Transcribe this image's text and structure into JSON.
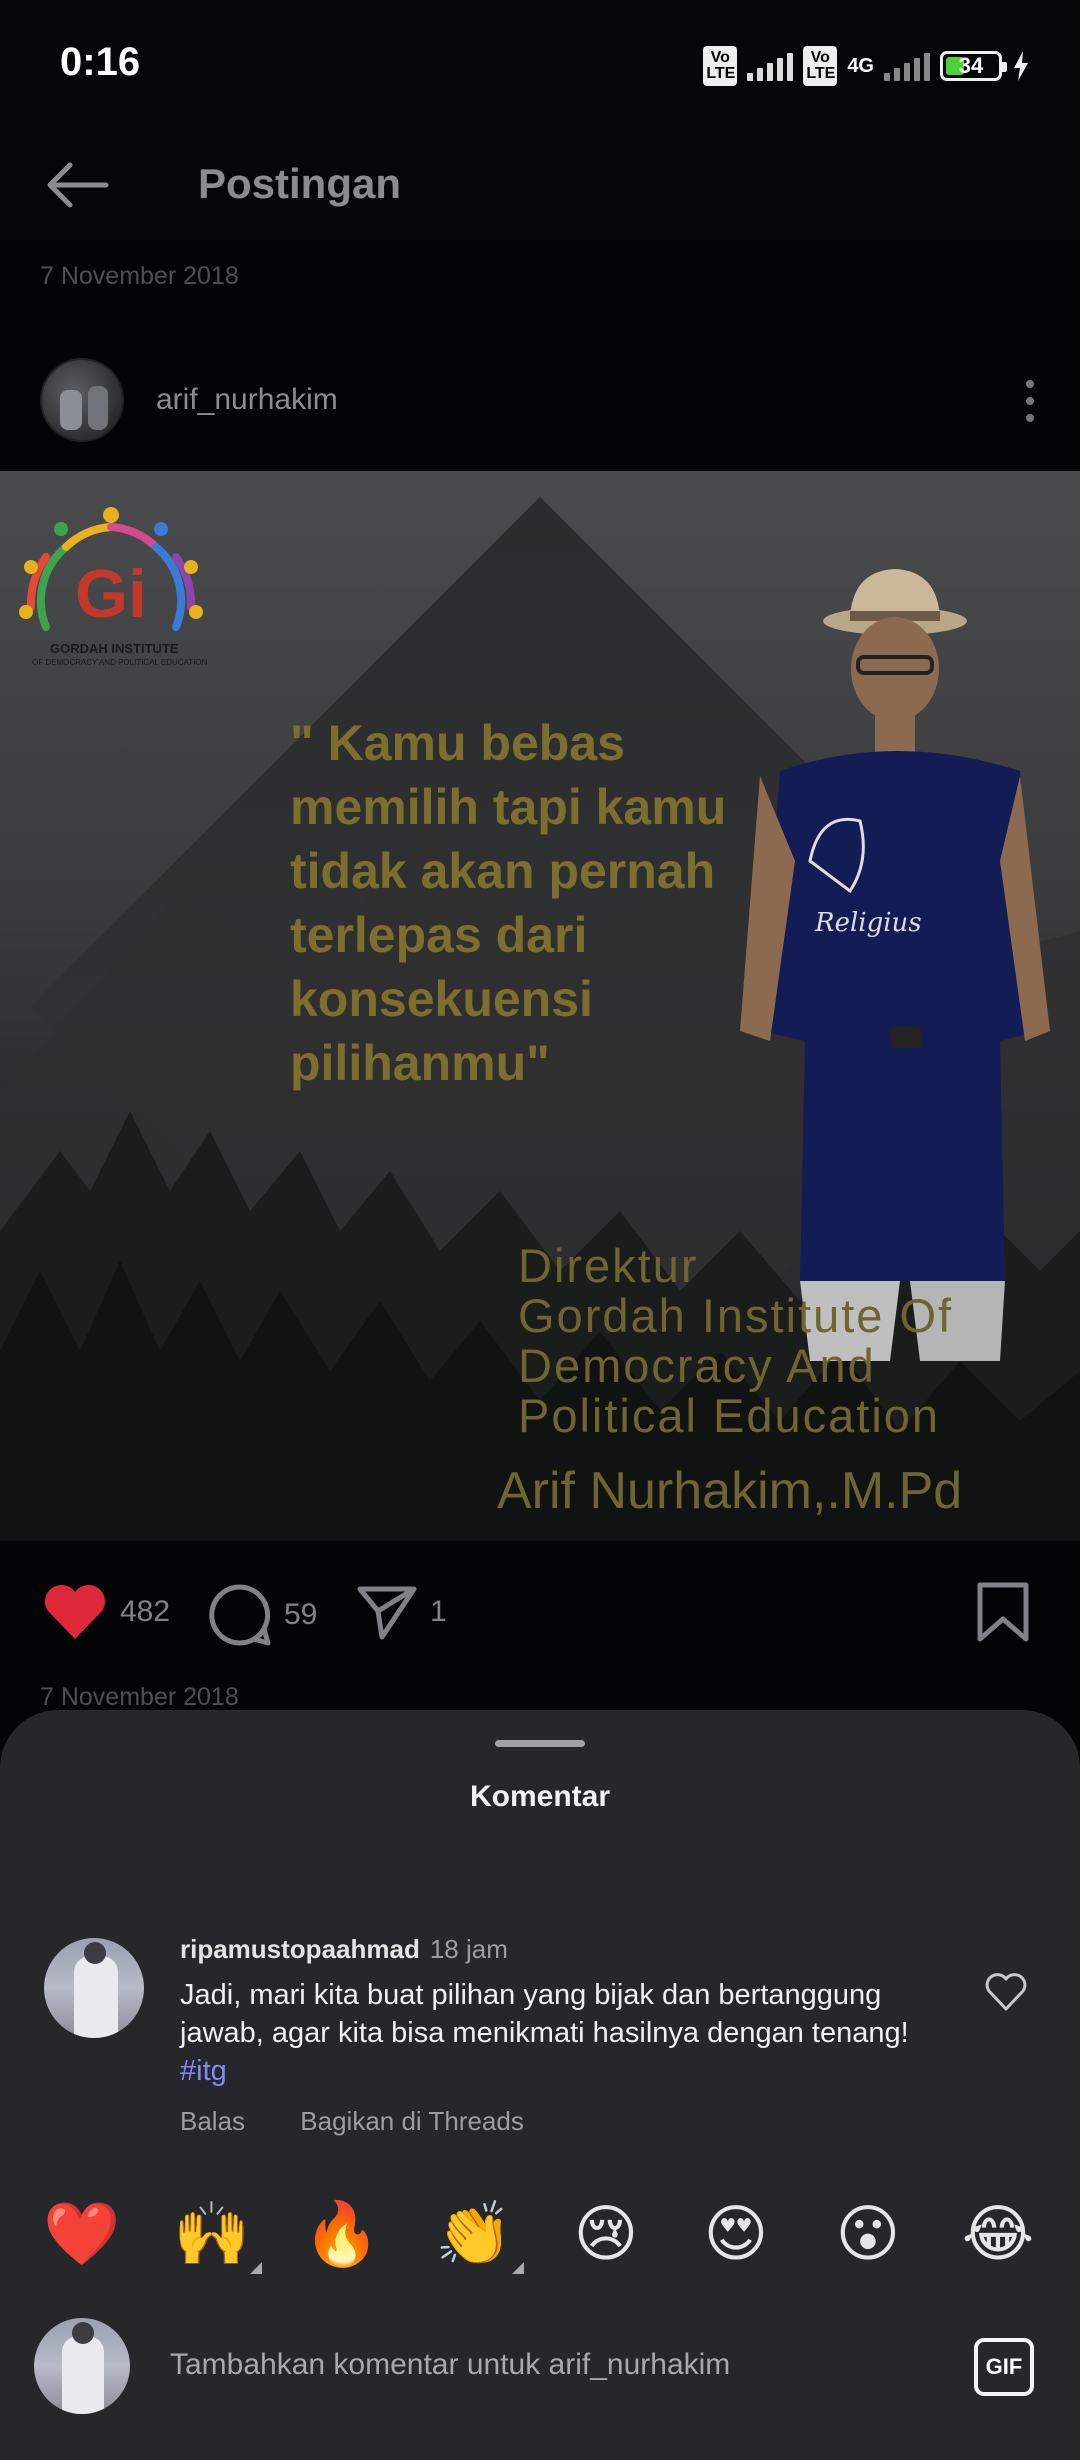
{
  "status_bar": {
    "time": "0:16",
    "volte1": "Vo LTE",
    "volte2": "Vo LTE",
    "network": "4G",
    "battery": "34",
    "battery_level": 0.34
  },
  "header": {
    "back_icon": "arrow-left-icon",
    "title": "Postingan"
  },
  "post": {
    "date": "7 November 2018",
    "author": "arif_nurhakim",
    "menu_icon": "more-vertical-icon",
    "image": {
      "logo_text": "GORDAH INSTITUTE",
      "logo_subtext": "OF DEMOCRACY AND POLITICAL EDUCATION",
      "quote_lines": [
        "\" Kamu bebas",
        "memilih tapi kamu",
        "tidak akan pernah",
        "terlepas dari",
        "konsekuensi",
        "pilihanmu\""
      ],
      "title_lines": [
        "Direktur",
        "Gordah Institute Of",
        "Democracy And",
        "Political Education"
      ],
      "signature": "Arif Nurhakim,.M.Pd",
      "shirt_text": "Religius"
    },
    "likes": "482",
    "comments": "59",
    "shares": "1",
    "date_bottom": "7 November 2018"
  },
  "sheet": {
    "title": "Komentar",
    "comment": {
      "user": "ripamustopaahmad",
      "time": "18 jam",
      "text": "Jadi, mari kita buat pilihan yang bijak dan bertanggung jawab, agar kita bisa menikmati hasilnya dengan tenang!",
      "hashtag": "#itg",
      "reply": "Balas",
      "share_threads": "Bagikan di Threads"
    },
    "emojis": [
      "❤️",
      "🙌",
      "🔥",
      "👏",
      "😢",
      "😍",
      "😮",
      "😂"
    ],
    "input_placeholder": "Tambahkan komentar untuk arif_nurhakim",
    "gif_label": "GIF"
  },
  "colors": {
    "like_red": "#e0283b",
    "quote_gold": "#7c6f2e",
    "hashtag": "#7d8cf7",
    "sheet_bg": "#25272b"
  }
}
